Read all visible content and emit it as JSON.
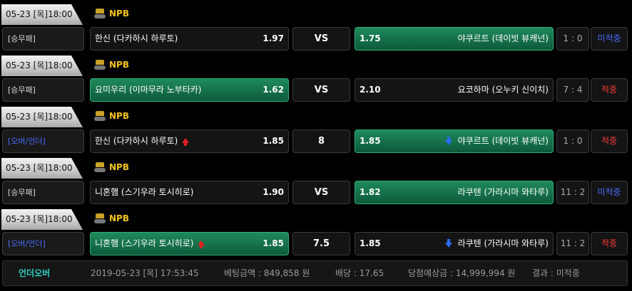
{
  "games": [
    {
      "date": "05-23 [목]18:00",
      "league": "NPB",
      "league_icon": "trophy-icon",
      "bet_type": "[승무패]",
      "bet_type_color": "default",
      "home": "한신 (다카하시 하루토)",
      "home_odds": "1.97",
      "home_selected": false,
      "home_arrow": "",
      "middle": "VS",
      "away": "야쿠르트 (데이빗 뷰캐넌)",
      "away_odds": "1.75",
      "away_selected": true,
      "away_arrow": "",
      "score": "1 : 0",
      "result": "미적중",
      "result_color": "blue"
    },
    {
      "date": "05-23 [목]18:00",
      "league": "NPB",
      "league_icon": "trophy-icon",
      "bet_type": "[승무패]",
      "bet_type_color": "default",
      "home": "요미우리 (이마무라 노부타카)",
      "home_odds": "1.62",
      "home_selected": true,
      "home_arrow": "",
      "middle": "VS",
      "away": "요코하마 (오누키 신이치)",
      "away_odds": "2.10",
      "away_selected": false,
      "away_arrow": "",
      "score": "7 : 4",
      "result": "적중",
      "result_color": "red"
    },
    {
      "date": "05-23 [목]18:00",
      "league": "NPB",
      "league_icon": "trophy-icon",
      "bet_type": "[오버/언더]",
      "bet_type_color": "blue",
      "home": "한신 (다카하시 하루토)",
      "home_odds": "1.85",
      "home_selected": false,
      "home_arrow": "up",
      "middle": "8",
      "away": "야쿠르트 (데이빗 뷰캐넌)",
      "away_odds": "1.85",
      "away_selected": true,
      "away_arrow": "down",
      "score": "1 : 0",
      "result": "적중",
      "result_color": "red"
    },
    {
      "date": "05-23 [목]18:00",
      "league": "NPB",
      "league_icon": "trophy-icon",
      "bet_type": "[승무패]",
      "bet_type_color": "default",
      "home": "니혼햄 (스기우라 토시히로)",
      "home_odds": "1.90",
      "home_selected": false,
      "home_arrow": "",
      "middle": "VS",
      "away": "라쿠텐 (가라시마 와타루)",
      "away_odds": "1.82",
      "away_selected": true,
      "away_arrow": "",
      "score": "11 : 2",
      "result": "미적중",
      "result_color": "blue"
    },
    {
      "date": "05-23 [목]18:00",
      "league": "NPB",
      "league_icon": "trophy-icon",
      "bet_type": "[오버/언더]",
      "bet_type_color": "blue",
      "home": "니혼햄 (스기우라 토시히로)",
      "home_odds": "1.85",
      "home_selected": true,
      "home_arrow": "up",
      "middle": "7.5",
      "away": "라쿠텐 (가라시마 와타루)",
      "away_odds": "1.85",
      "away_selected": false,
      "away_arrow": "down",
      "score": "11 : 2",
      "result": "적중",
      "result_color": "red"
    }
  ],
  "summary": {
    "type": "언더오버",
    "datetime": "2019-05-23 [목] 17:53:45",
    "bet_amount": "베팅금액 : 849,858 원",
    "odds": "배당 : 17.65",
    "expected": "당첨예상금 : 14,999,994 원",
    "result": "결과 : 미적중"
  },
  "colors": {
    "selected_green": "#1f8a5c",
    "league_yellow": "#f2c21b",
    "hit_red": "#ff3b3b",
    "miss_blue": "#4a6cff",
    "summary_type_cyan": "#2fd0c0"
  }
}
